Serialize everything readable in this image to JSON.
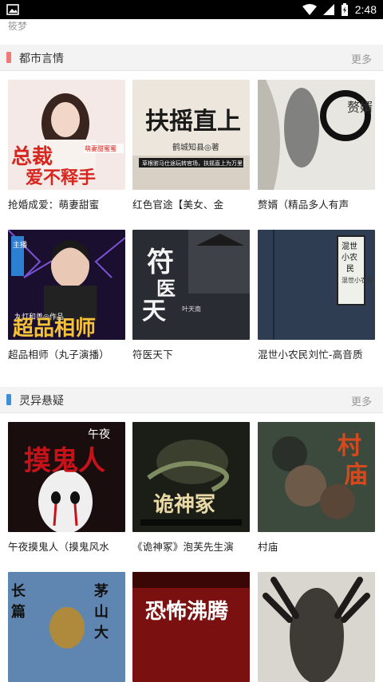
{
  "status_bar": {
    "time": "2:48"
  },
  "top_partial_text": "筱梦",
  "sections": [
    {
      "title": "都市言情",
      "more": "更多",
      "accent": "#f07876",
      "books": [
        {
          "title": "抢婚成爱：萌妻甜蜜",
          "cover_text": "总裁爱不释手",
          "cover_sub": "萌妻甜蜜蜜"
        },
        {
          "title": "红色官途【美女、金",
          "cover_text": "扶摇直上",
          "cover_sub": "鹤城知县◎著"
        },
        {
          "title": "赘婿（精品多人有声",
          "cover_text": "赘婿",
          "cover_sub": ""
        },
        {
          "title": "超品相师（丸子演播）",
          "cover_text": "超品相师",
          "cover_sub": "九灯和善◎作品"
        },
        {
          "title": "符医天下",
          "cover_text": "符医天下",
          "cover_sub": "叶天南"
        },
        {
          "title": "混世小农民刘忙-高音质",
          "cover_text": "混世小农民",
          "cover_sub": ""
        }
      ]
    },
    {
      "title": "灵异悬疑",
      "more": "更多",
      "accent": "#3d8fd9",
      "books": [
        {
          "title": "午夜摸鬼人（摸鬼风水",
          "cover_text": "摸鬼人",
          "cover_sub": "午夜"
        },
        {
          "title": "《诡神冢》泡芙先生演",
          "cover_text": "诡神冢",
          "cover_sub": ""
        },
        {
          "title": "村庙",
          "cover_text": "村庙",
          "cover_sub": ""
        },
        {
          "title": "",
          "cover_text": "茅山",
          "cover_sub": "长篇"
        },
        {
          "title": "",
          "cover_text": "恐怖沸腾",
          "cover_sub": ""
        },
        {
          "title": "",
          "cover_text": "",
          "cover_sub": ""
        }
      ]
    }
  ]
}
